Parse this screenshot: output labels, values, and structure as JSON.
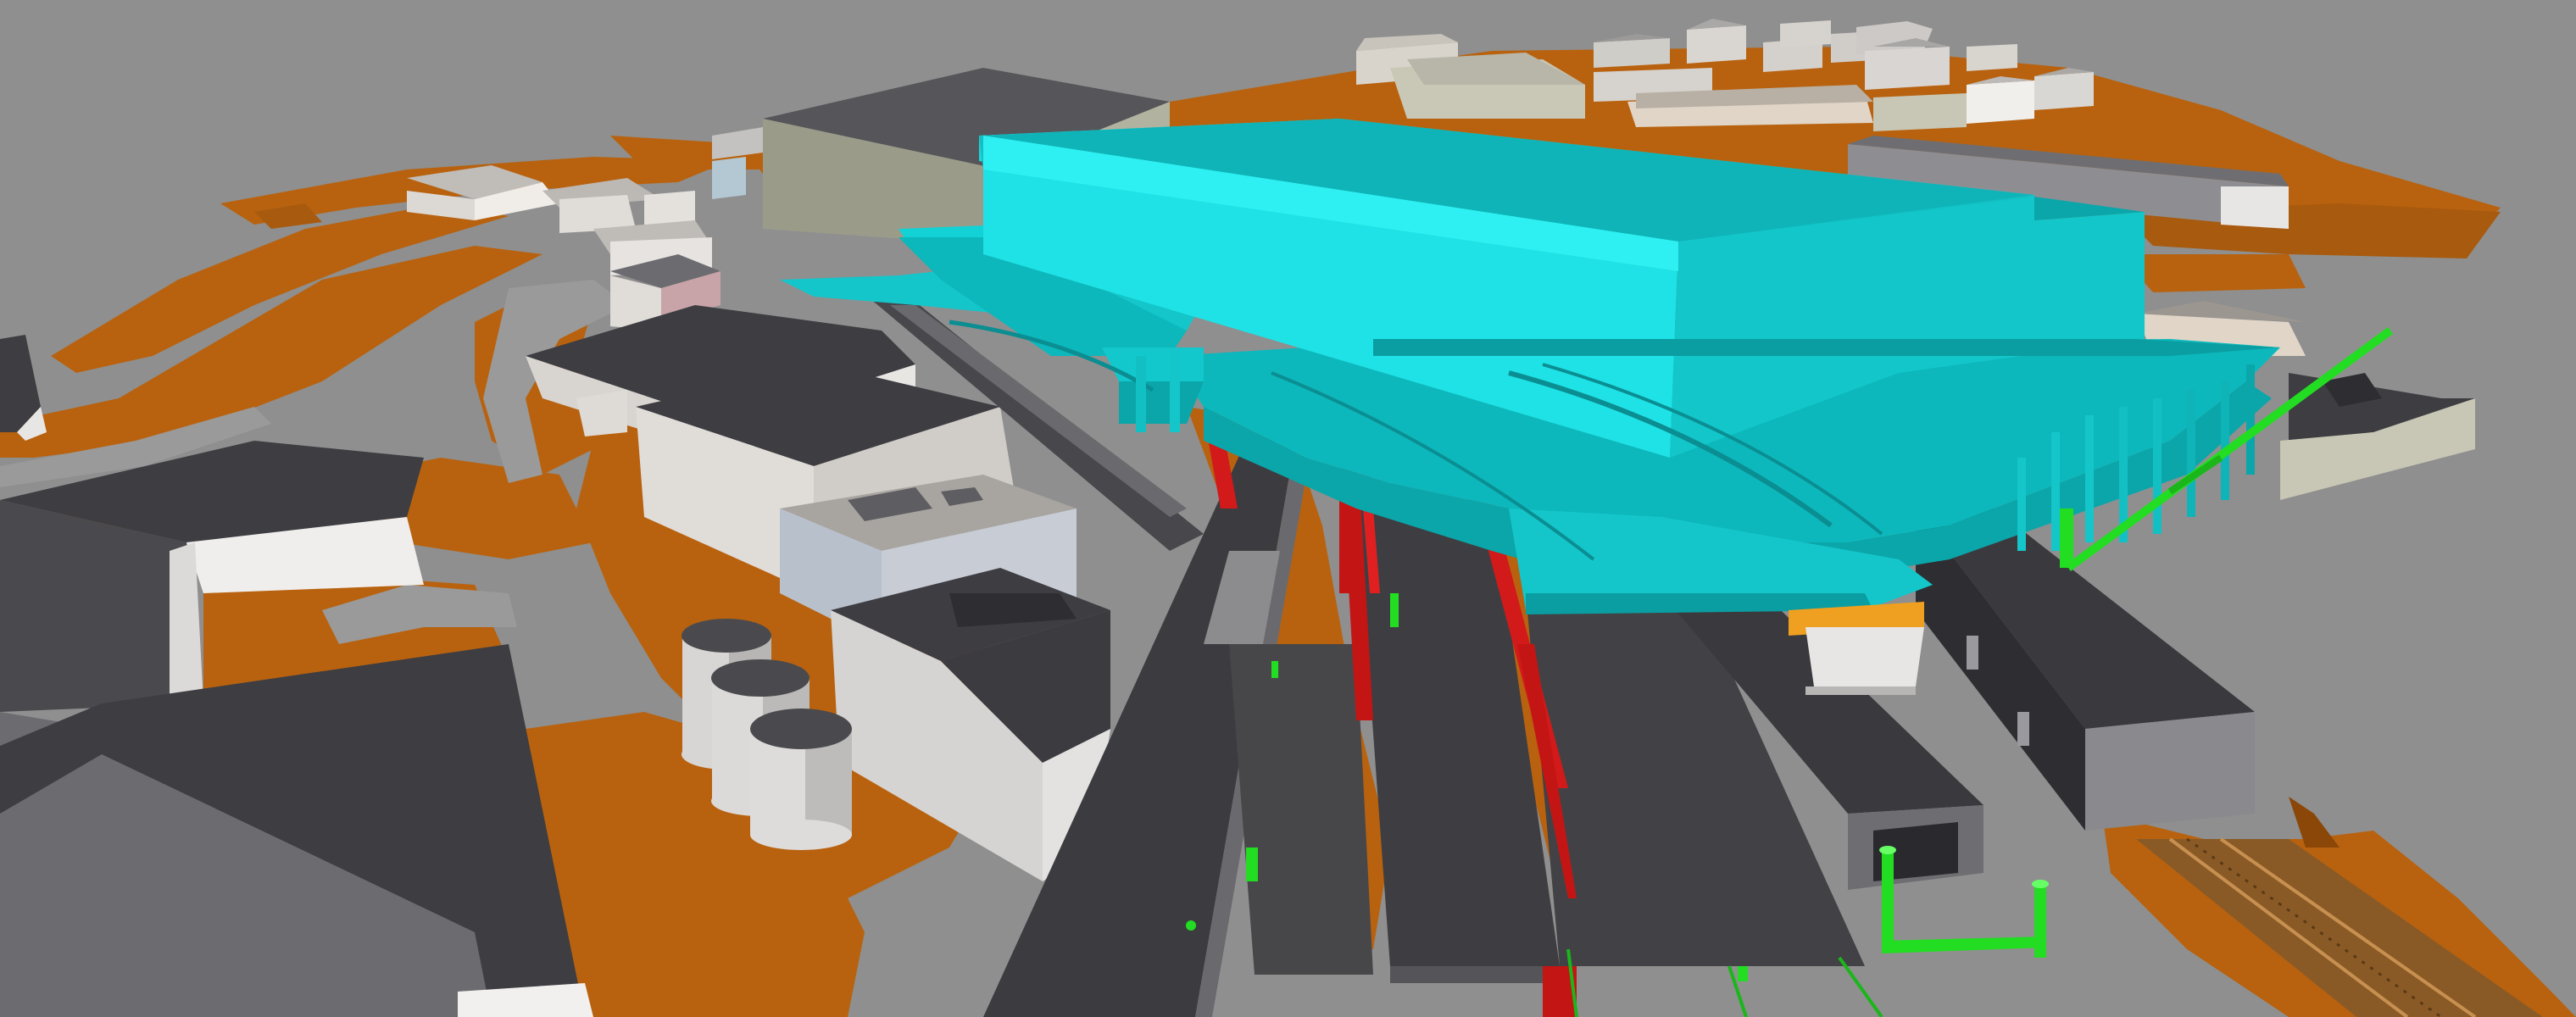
{
  "colors": {
    "background": "#8f8f8f",
    "terrain": "#b8620f",
    "terrain_dark": "#8a4708",
    "road": "#9a9a9a",
    "station_cyan": "#12d8dc",
    "station_cyan_light": "#34eef0",
    "station_cyan_dark": "#0aa6aa",
    "roof_dark": "#3d3d42",
    "wall_white": "#e8e6e4",
    "wall_grey": "#b8b8bc",
    "structure_red": "#d21a1a",
    "utility_green": "#22dd22",
    "platform_orange": "#f0a020",
    "rail_brown": "#7a4a1a"
  },
  "scene": {
    "elements": [
      "terrain-surface",
      "station-building",
      "track-trenches",
      "surrounding-buildings",
      "storage-silos",
      "utility-pipes",
      "support-columns",
      "railway-tracks"
    ]
  }
}
